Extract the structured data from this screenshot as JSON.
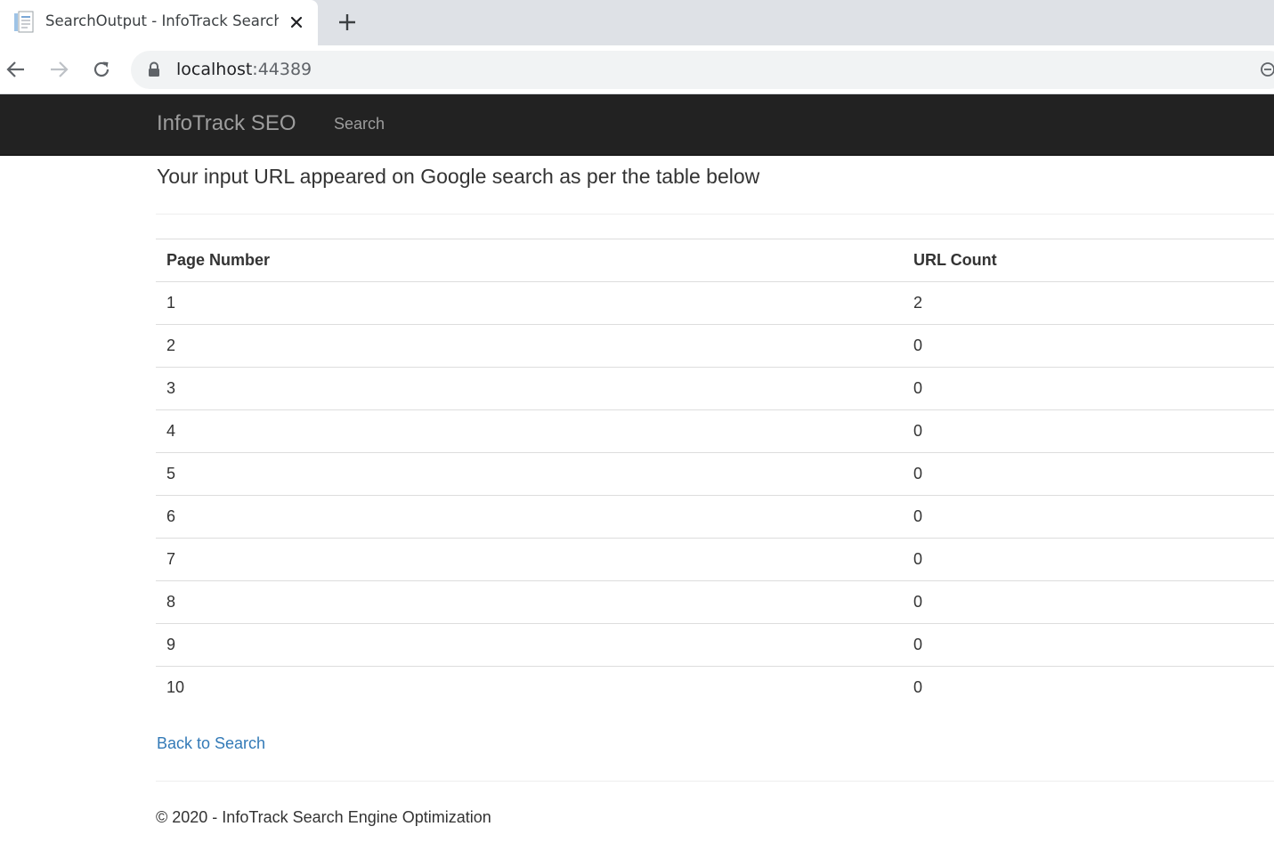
{
  "browser": {
    "tab": {
      "title": "SearchOutput - InfoTrack Search",
      "favicon": "page-icon"
    },
    "address_bar": {
      "host": "localhost",
      "port": ":44389"
    }
  },
  "navbar": {
    "brand": "InfoTrack SEO",
    "links": [
      "Search"
    ],
    "background_color": "#222222",
    "link_color": "#9d9d9d"
  },
  "main": {
    "heading": "Your input URL appeared on Google search as per the table below",
    "table": {
      "columns": [
        "Page Number",
        "URL Count"
      ],
      "rows": [
        [
          "1",
          "2"
        ],
        [
          "2",
          "0"
        ],
        [
          "3",
          "0"
        ],
        [
          "4",
          "0"
        ],
        [
          "5",
          "0"
        ],
        [
          "6",
          "0"
        ],
        [
          "7",
          "0"
        ],
        [
          "8",
          "0"
        ],
        [
          "9",
          "0"
        ],
        [
          "10",
          "0"
        ]
      ]
    },
    "back_link": "Back to Search",
    "link_color": "#337ab7"
  },
  "footer": {
    "text": "© 2020 - InfoTrack Search Engine Optimization"
  }
}
